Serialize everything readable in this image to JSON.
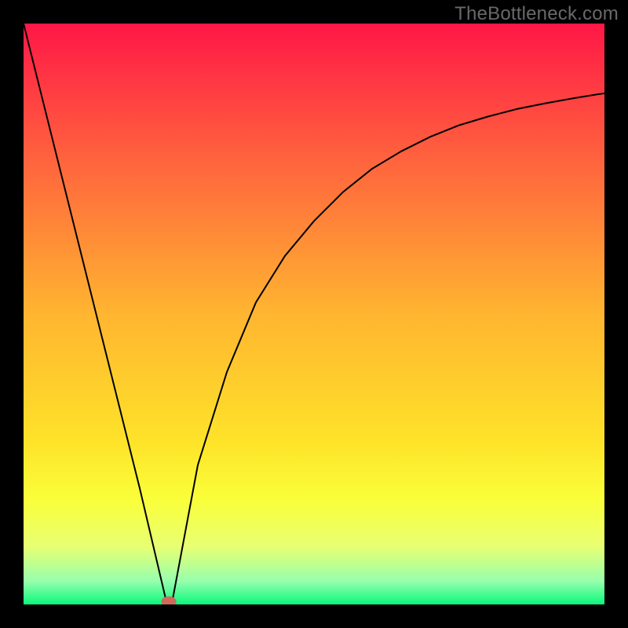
{
  "watermark": "TheBottleneck.com",
  "chart_data": {
    "type": "line",
    "title": "",
    "xlabel": "",
    "ylabel": "",
    "xlim": [
      0,
      100
    ],
    "ylim": [
      0,
      100
    ],
    "grid": false,
    "series": [
      {
        "name": "curve",
        "color": "#000000",
        "x": [
          0,
          5,
          10,
          15,
          20,
          24.7,
          25.5,
          30,
          35,
          40,
          45,
          50,
          55,
          60,
          65,
          70,
          75,
          80,
          85,
          90,
          95,
          100
        ],
        "values": [
          100,
          80,
          60,
          40,
          20,
          0,
          0,
          24,
          40,
          52,
          60,
          66,
          71,
          75,
          78,
          80.5,
          82.5,
          84,
          85.3,
          86.3,
          87.2,
          88
        ]
      }
    ],
    "marker": {
      "x": 25,
      "y": 0.5,
      "color": "#cf6a5b"
    },
    "background_gradient": {
      "stops": [
        {
          "color": "#ff1747",
          "pos": 0.0
        },
        {
          "color": "#ff683d",
          "pos": 0.25
        },
        {
          "color": "#ffb530",
          "pos": 0.5
        },
        {
          "color": "#fee329",
          "pos": 0.72
        },
        {
          "color": "#faff3a",
          "pos": 0.82
        },
        {
          "color": "#e8ff72",
          "pos": 0.9
        },
        {
          "color": "#96ffad",
          "pos": 0.96
        },
        {
          "color": "#0bf87d",
          "pos": 1.0
        }
      ]
    }
  }
}
